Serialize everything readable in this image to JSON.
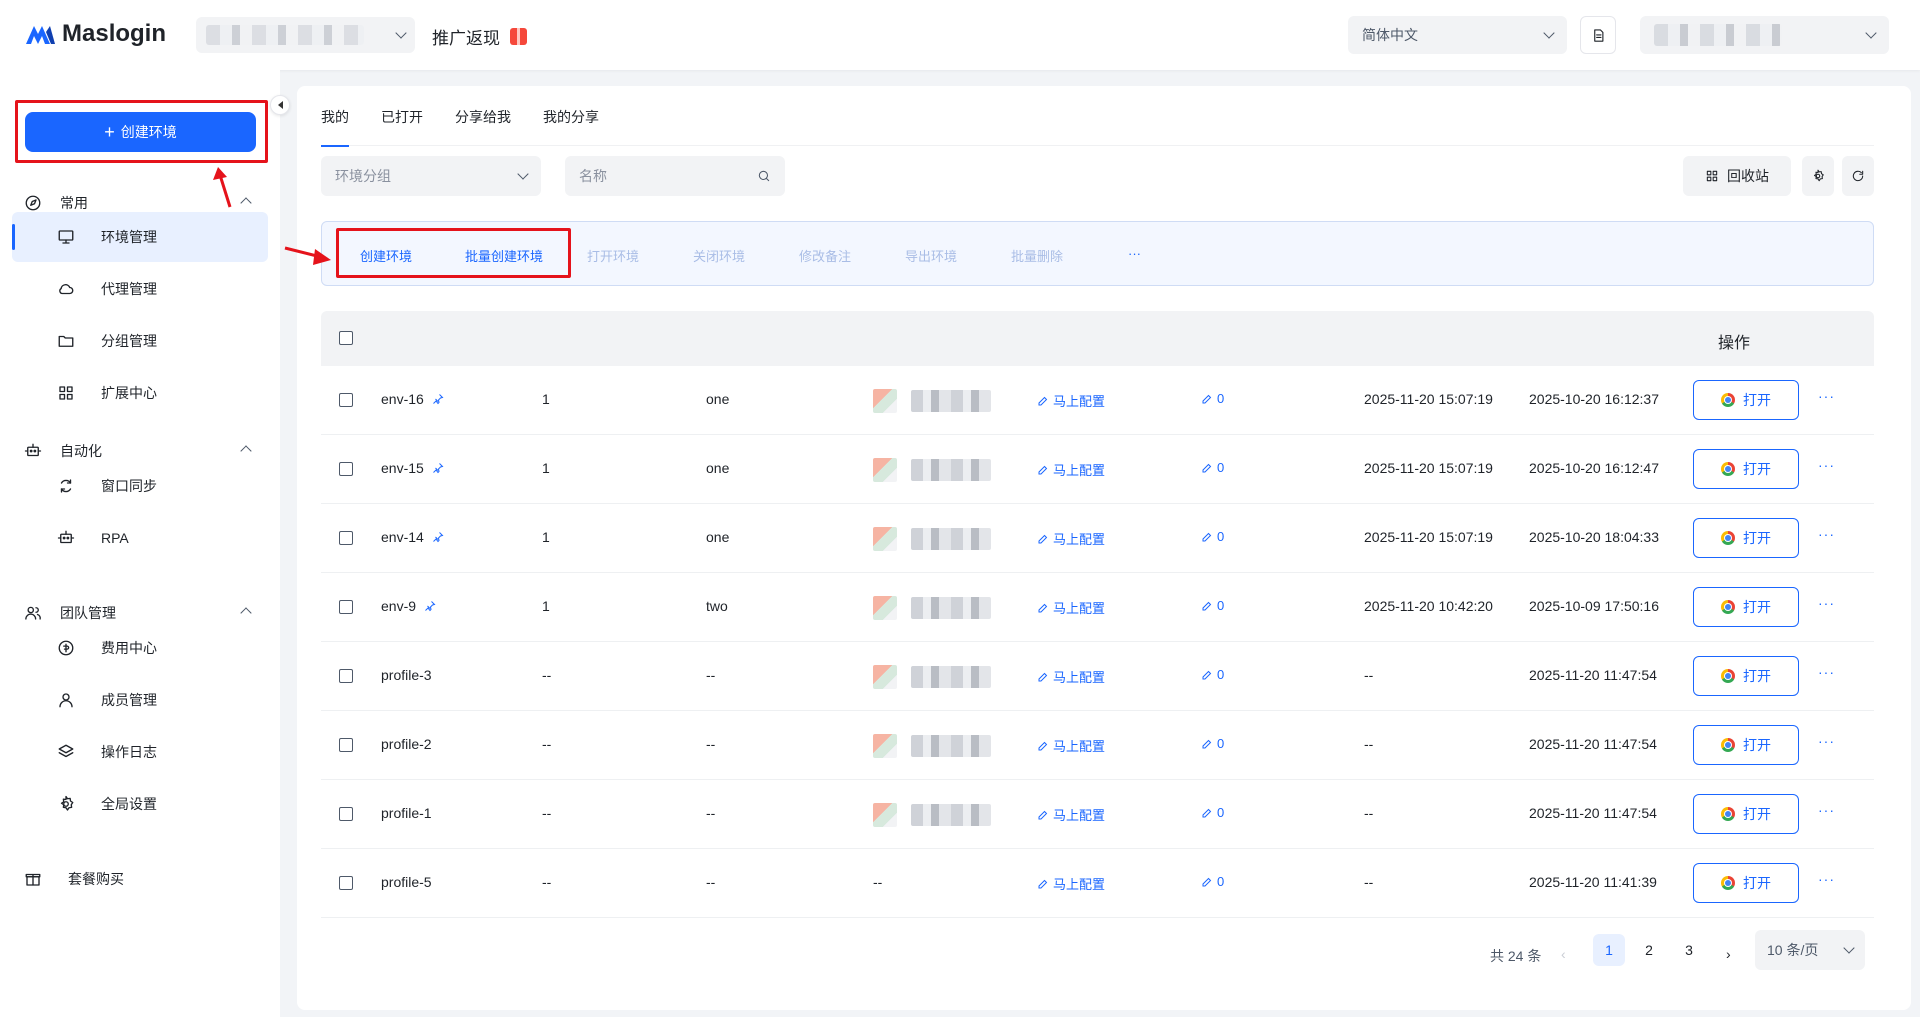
{
  "header": {
    "brand": "Maslogin",
    "promo_label": "推广返现",
    "language": "简体中文"
  },
  "sidebar": {
    "create_button": "创建环境",
    "groups": [
      {
        "label": "常用",
        "items": [
          {
            "label": "环境管理",
            "icon": "monitor-icon",
            "active": true
          },
          {
            "label": "代理管理",
            "icon": "cloud-icon"
          },
          {
            "label": "分组管理",
            "icon": "folder-icon"
          },
          {
            "label": "扩展中心",
            "icon": "grid-icon"
          }
        ]
      },
      {
        "label": "自动化",
        "items": [
          {
            "label": "窗口同步",
            "icon": "sync-icon"
          },
          {
            "label": "RPA",
            "icon": "robot-icon"
          }
        ]
      },
      {
        "label": "团队管理",
        "items": [
          {
            "label": "费用中心",
            "icon": "billing-icon"
          },
          {
            "label": "成员管理",
            "icon": "user-icon"
          },
          {
            "label": "操作日志",
            "icon": "layers-icon"
          },
          {
            "label": "全局设置",
            "icon": "gear-icon"
          }
        ]
      }
    ],
    "package": "套餐购买"
  },
  "tabs": [
    "我的",
    "已打开",
    "分享给我",
    "我的分享"
  ],
  "filters": {
    "group_placeholder": "环境分组",
    "name_placeholder": "名称",
    "recycle_label": "回收站"
  },
  "actions": [
    "创建环境",
    "批量创建环境",
    "打开环境",
    "关闭环境",
    "修改备注",
    "导出环境",
    "批量删除",
    "···"
  ],
  "table": {
    "op_header": "操作",
    "config_label": "马上配置",
    "open_label": "打开",
    "more_label": "···",
    "rows": [
      {
        "name": "env-16",
        "pinned": true,
        "num": "1",
        "group": "one",
        "thumb": true,
        "note_count": "0",
        "opened": "2025-11-20 15:07:19",
        "created": "2025-10-20 16:12:37"
      },
      {
        "name": "env-15",
        "pinned": true,
        "num": "1",
        "group": "one",
        "thumb": true,
        "note_count": "0",
        "opened": "2025-11-20 15:07:19",
        "created": "2025-10-20 16:12:47"
      },
      {
        "name": "env-14",
        "pinned": true,
        "num": "1",
        "group": "one",
        "thumb": true,
        "note_count": "0",
        "opened": "2025-11-20 15:07:19",
        "created": "2025-10-20 18:04:33"
      },
      {
        "name": "env-9",
        "pinned": true,
        "num": "1",
        "group": "two",
        "thumb": true,
        "note_count": "0",
        "opened": "2025-11-20 10:42:20",
        "created": "2025-10-09 17:50:16"
      },
      {
        "name": "profile-3",
        "pinned": false,
        "num": "--",
        "group": "--",
        "thumb": true,
        "note_count": "0",
        "opened": "--",
        "created": "2025-11-20 11:47:54"
      },
      {
        "name": "profile-2",
        "pinned": false,
        "num": "--",
        "group": "--",
        "thumb": true,
        "note_count": "0",
        "opened": "--",
        "created": "2025-11-20 11:47:54"
      },
      {
        "name": "profile-1",
        "pinned": false,
        "num": "--",
        "group": "--",
        "thumb": true,
        "note_count": "0",
        "opened": "--",
        "created": "2025-11-20 11:47:54"
      },
      {
        "name": "profile-5",
        "pinned": false,
        "num": "--",
        "group": "--",
        "thumb": false,
        "thumb_text": "--",
        "note_count": "0",
        "opened": "--",
        "created": "2025-11-20 11:41:39"
      }
    ]
  },
  "pagination": {
    "total": "共 24 条",
    "pages": [
      "1",
      "2",
      "3"
    ],
    "current": "1",
    "prev": "‹",
    "next": "›",
    "page_size": "10 条/页"
  },
  "colors": {
    "accent": "#1a66ff",
    "annotation": "#e5131b"
  }
}
